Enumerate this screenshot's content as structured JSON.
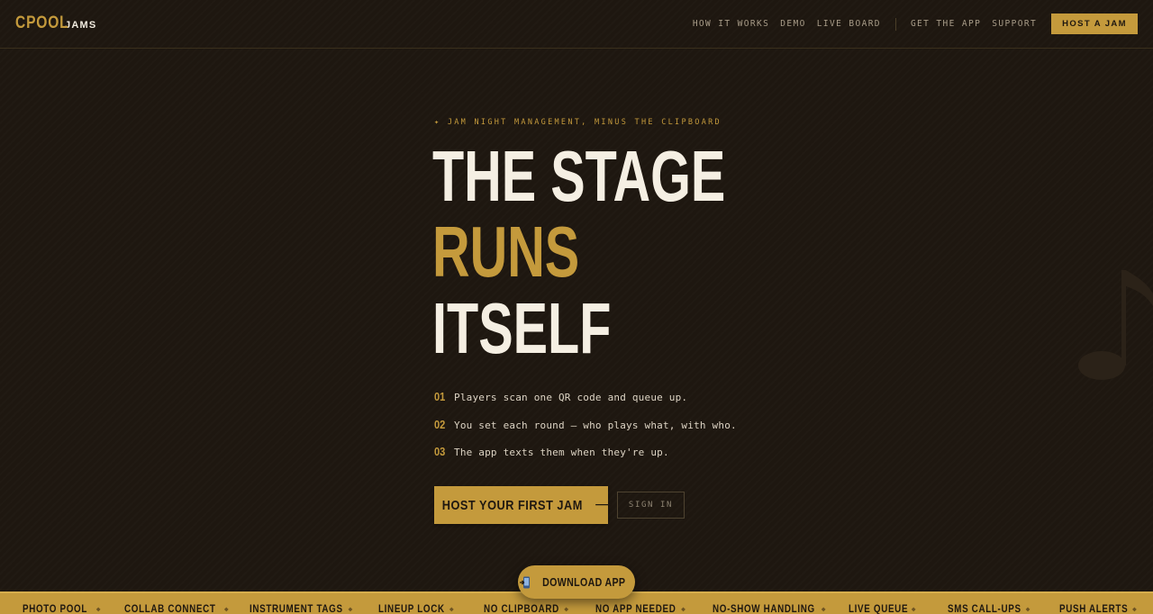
{
  "brand": {
    "name": "CPOOL",
    "sub": "JAMS",
    "accent": "#c49a3c",
    "background": "#1e1710"
  },
  "nav": {
    "links": [
      "HOW IT WORKS",
      "DEMO",
      "LIVE BOARD",
      "GET THE APP",
      "SUPPORT"
    ],
    "cta": "HOST A JAM"
  },
  "hero": {
    "eyebrow": "✦ JAM NIGHT MANAGEMENT, MINUS THE CLIPBOARD",
    "headline": [
      "THE STAGE",
      "RUNS",
      "ITSELF"
    ],
    "steps": [
      {
        "num": "01",
        "text": "Players scan one QR code and queue up."
      },
      {
        "num": "02",
        "text": "You set each round — who plays what, with who."
      },
      {
        "num": "03",
        "text": "The app texts them when they're up."
      }
    ],
    "primary_cta": "HOST YOUR FIRST JAM",
    "primary_cta_icon": "arrow-right-icon",
    "secondary_cta": "SIGN IN"
  },
  "download": {
    "label": "DOWNLOAD APP",
    "icon": "phone-icon"
  },
  "ticker": {
    "items": [
      "PHOTO POOL",
      "COLLAB CONNECT",
      "INSTRUMENT TAGS",
      "LINEUP LOCK",
      "NO CLIPBOARD",
      "NO APP NEEDED",
      "NO-SHOW HANDLING",
      "LIVE QUEUE",
      "SMS CALL-UPS",
      "PUSH ALERTS"
    ],
    "separator": "◆"
  },
  "decor": {
    "icon": "music-note-icon"
  }
}
